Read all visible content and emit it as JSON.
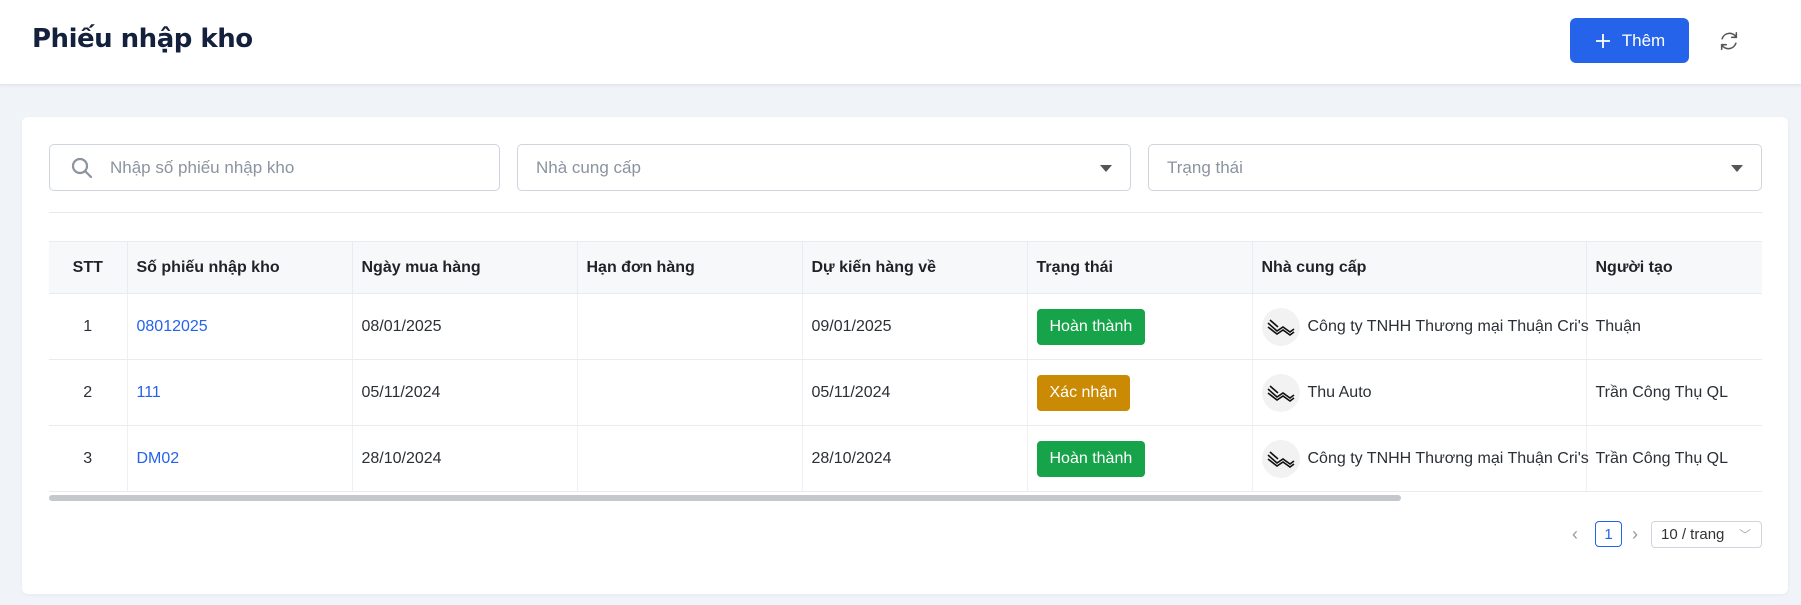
{
  "header": {
    "title": "Phiếu nhập kho",
    "add_label": "Thêm",
    "accent": "#2563eb"
  },
  "filters": {
    "search_placeholder": "Nhập số phiếu nhập kho",
    "supplier_placeholder": "Nhà cung cấp",
    "status_placeholder": "Trạng thái"
  },
  "table": {
    "columns": [
      "STT",
      "Số phiếu nhập kho",
      "Ngày mua hàng",
      "Hạn đơn hàng",
      "Dự kiến hàng về",
      "Trạng thái",
      "Nhà cung cấp",
      "Người tạo"
    ],
    "rows": [
      {
        "stt": "1",
        "code": "08012025",
        "purchase_date": "08/01/2025",
        "deadline": "",
        "expected": "09/01/2025",
        "status": "Hoàn thành",
        "status_color": "#16a34a",
        "supplier": "Công ty TNHH Thương mại Thuận Cri's",
        "creator": "Thuận"
      },
      {
        "stt": "2",
        "code": "111",
        "purchase_date": "05/11/2024",
        "deadline": "",
        "expected": "05/11/2024",
        "status": "Xác nhận",
        "status_color": "#ca8a04",
        "supplier": "Thu Auto",
        "creator": "Trần Công Thụ QL"
      },
      {
        "stt": "3",
        "code": "DM02",
        "purchase_date": "28/10/2024",
        "deadline": "",
        "expected": "28/10/2024",
        "status": "Hoàn thành",
        "status_color": "#16a34a",
        "supplier": "Công ty TNHH Thương mại Thuận Cri's",
        "creator": "Trần Công Thụ QL"
      }
    ]
  },
  "pagination": {
    "current_page": "1",
    "page_size": "10 / trang"
  }
}
